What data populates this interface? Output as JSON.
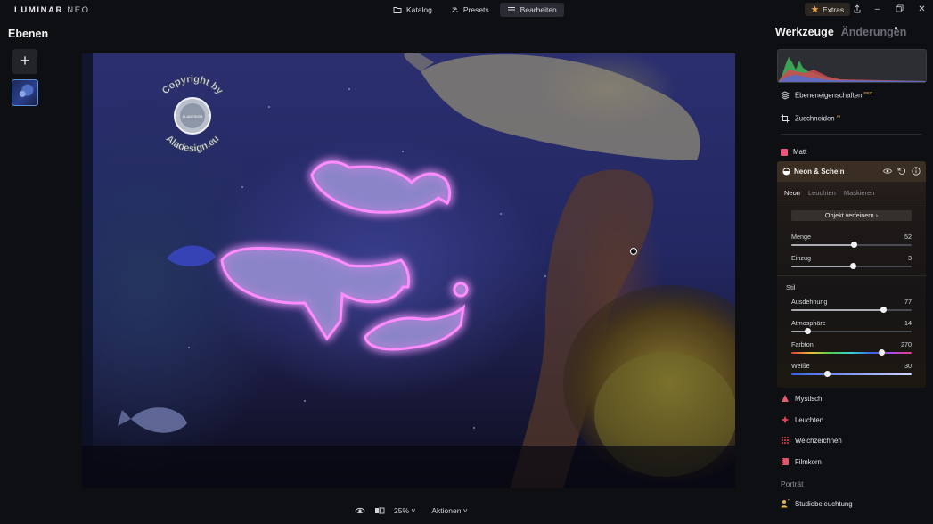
{
  "app": {
    "brand_main": "LUMINAR",
    "brand_suffix": "NEO"
  },
  "topnav": {
    "catalog": "Katalog",
    "presets": "Presets",
    "edit": "Bearbeiten"
  },
  "extras": {
    "label": "Extras"
  },
  "left_panel": {
    "title": "Ebenen"
  },
  "bottom_bar": {
    "zoom": "25%",
    "actions": "Aktionen"
  },
  "watermark": {
    "top_text": "Copyright by",
    "bottom_text": "Aladesign.eu",
    "center_text": "ALADESIGN"
  },
  "right_panel": {
    "tab_tools": "Werkzeuge",
    "tab_changes": "Änderungen",
    "layer_properties": "Ebeneneigenschaften",
    "layer_properties_tag": "PRO",
    "crop": "Zuschneiden",
    "crop_tag": "AI",
    "matte": "Matt",
    "neon": {
      "title": "Neon & Schein",
      "subtabs": [
        "Neon",
        "Leuchten",
        "Maskieren"
      ],
      "refine_button": "Objekt verfeinern",
      "style_label": "Stil",
      "sliders": [
        {
          "label": "Menge",
          "value": 52,
          "fraction": 0.52,
          "kind": "plain"
        },
        {
          "label": "Einzug",
          "value": 3,
          "fraction": 0.515,
          "kind": "plain"
        },
        {
          "label": "Ausdehnung",
          "value": 77,
          "fraction": 0.77,
          "kind": "plain"
        },
        {
          "label": "Atmosphäre",
          "value": 14,
          "fraction": 0.14,
          "kind": "plain"
        },
        {
          "label": "Farbton",
          "value": 270,
          "fraction": 0.75,
          "kind": "hue"
        },
        {
          "label": "Weiße",
          "value": 30,
          "fraction": 0.3,
          "kind": "white"
        }
      ]
    },
    "tools": [
      "Mystisch",
      "Leuchten",
      "Weichzeichnen",
      "Filmkorn"
    ],
    "section_portrait": "Porträt",
    "studio_light": "Studiobeleuchtung",
    "tool_colors": {
      "mystic": "#e35b6f",
      "glow": "#e0405a",
      "blur": "#d9434f",
      "grain": "#e2566b",
      "matte": "#e8587a"
    }
  }
}
